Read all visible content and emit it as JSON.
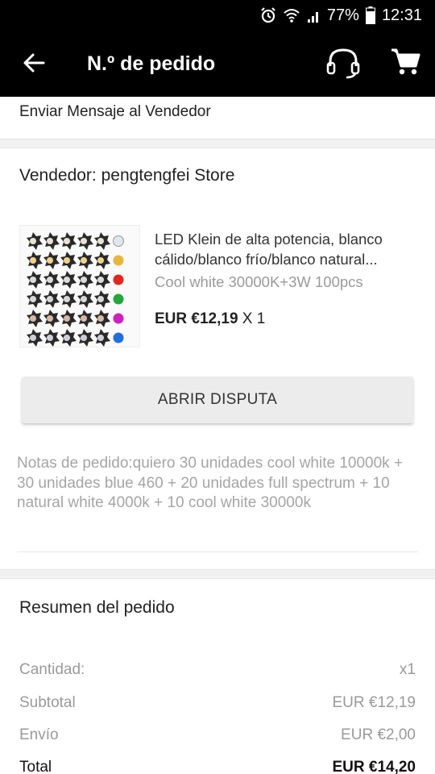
{
  "status_bar": {
    "battery_percent": "77%",
    "time": "12:31",
    "icons": [
      "alarm-icon",
      "wifi-icon",
      "signal-icon",
      "battery-icon"
    ]
  },
  "app_bar": {
    "title": "N.º de pedido",
    "icons": [
      "back-arrow-icon",
      "headset-support-icon",
      "shopping-cart-icon"
    ]
  },
  "message_seller": "Enviar Mensaje al Vendedor",
  "seller": {
    "label": "Vendedor: pengtengfei Store"
  },
  "product": {
    "title_line1": "LED Klein de alta potencia, blanco",
    "title_line2": "cálido/blanco frío/blanco natural...",
    "variant": "Cool white 30000K+3W 100pcs",
    "price": "EUR €12,19",
    "quantity": "X 1"
  },
  "dispute_button": "ABRIR DISPUTA",
  "notes": {
    "text": "Notas de pedido:quiero 30 unidades cool white 10000k + 30 unidades blue 460 + 20 unidades full spectrum + 10 natural white 4000k + 10 cool white 30000k"
  },
  "summary": {
    "title": "Resumen del pedido",
    "rows": [
      {
        "label": "Cantidad:",
        "value": "x1"
      },
      {
        "label": "Subtotal",
        "value": "EUR €12,19"
      },
      {
        "label": "Envío",
        "value": "EUR €2,00"
      },
      {
        "label": "Total",
        "value": "EUR €14,20"
      }
    ]
  },
  "colors": {
    "app_bar_bg": "#000000",
    "separator": "#f1f1f1",
    "muted_text": "#9a9a9a",
    "button_bg": "#ececec"
  }
}
